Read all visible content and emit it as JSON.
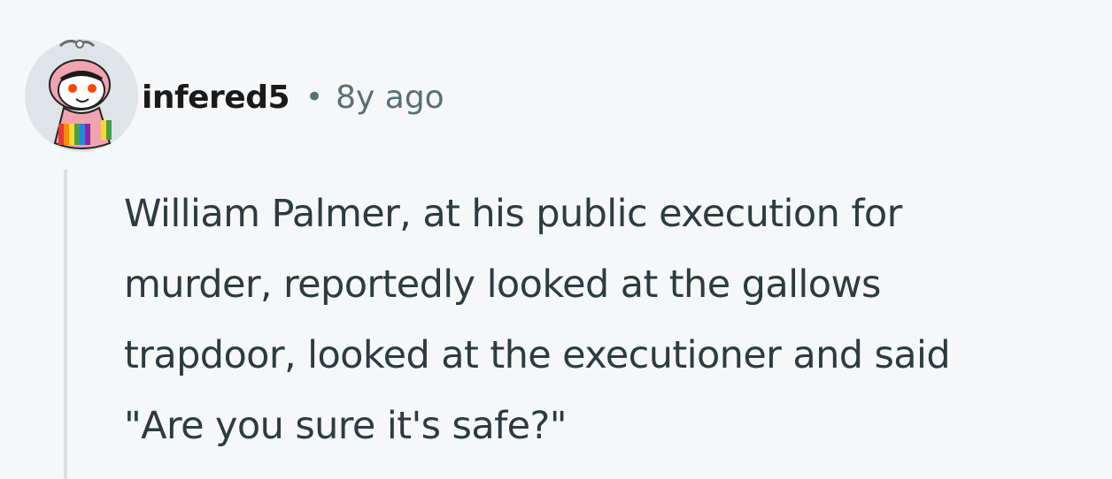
{
  "comment": {
    "author": "infered5",
    "separator": "•",
    "timestamp": "8y ago",
    "avatar_icon": "snoo-avatar-icon",
    "lines": [
      "William Palmer, at his public execution for",
      "murder, reportedly looked at the gallows",
      "trapdoor, looked at the executioner and said",
      "\"Are you sure it's safe?\""
    ]
  },
  "colors": {
    "background": "#f6f7f8",
    "meta_text": "#576f76",
    "thread_line": "#d9dee3",
    "body_text": "#2a3c42",
    "avatar_hood": "#f2a3b0",
    "avatar_bg": "#dfe4e8"
  }
}
